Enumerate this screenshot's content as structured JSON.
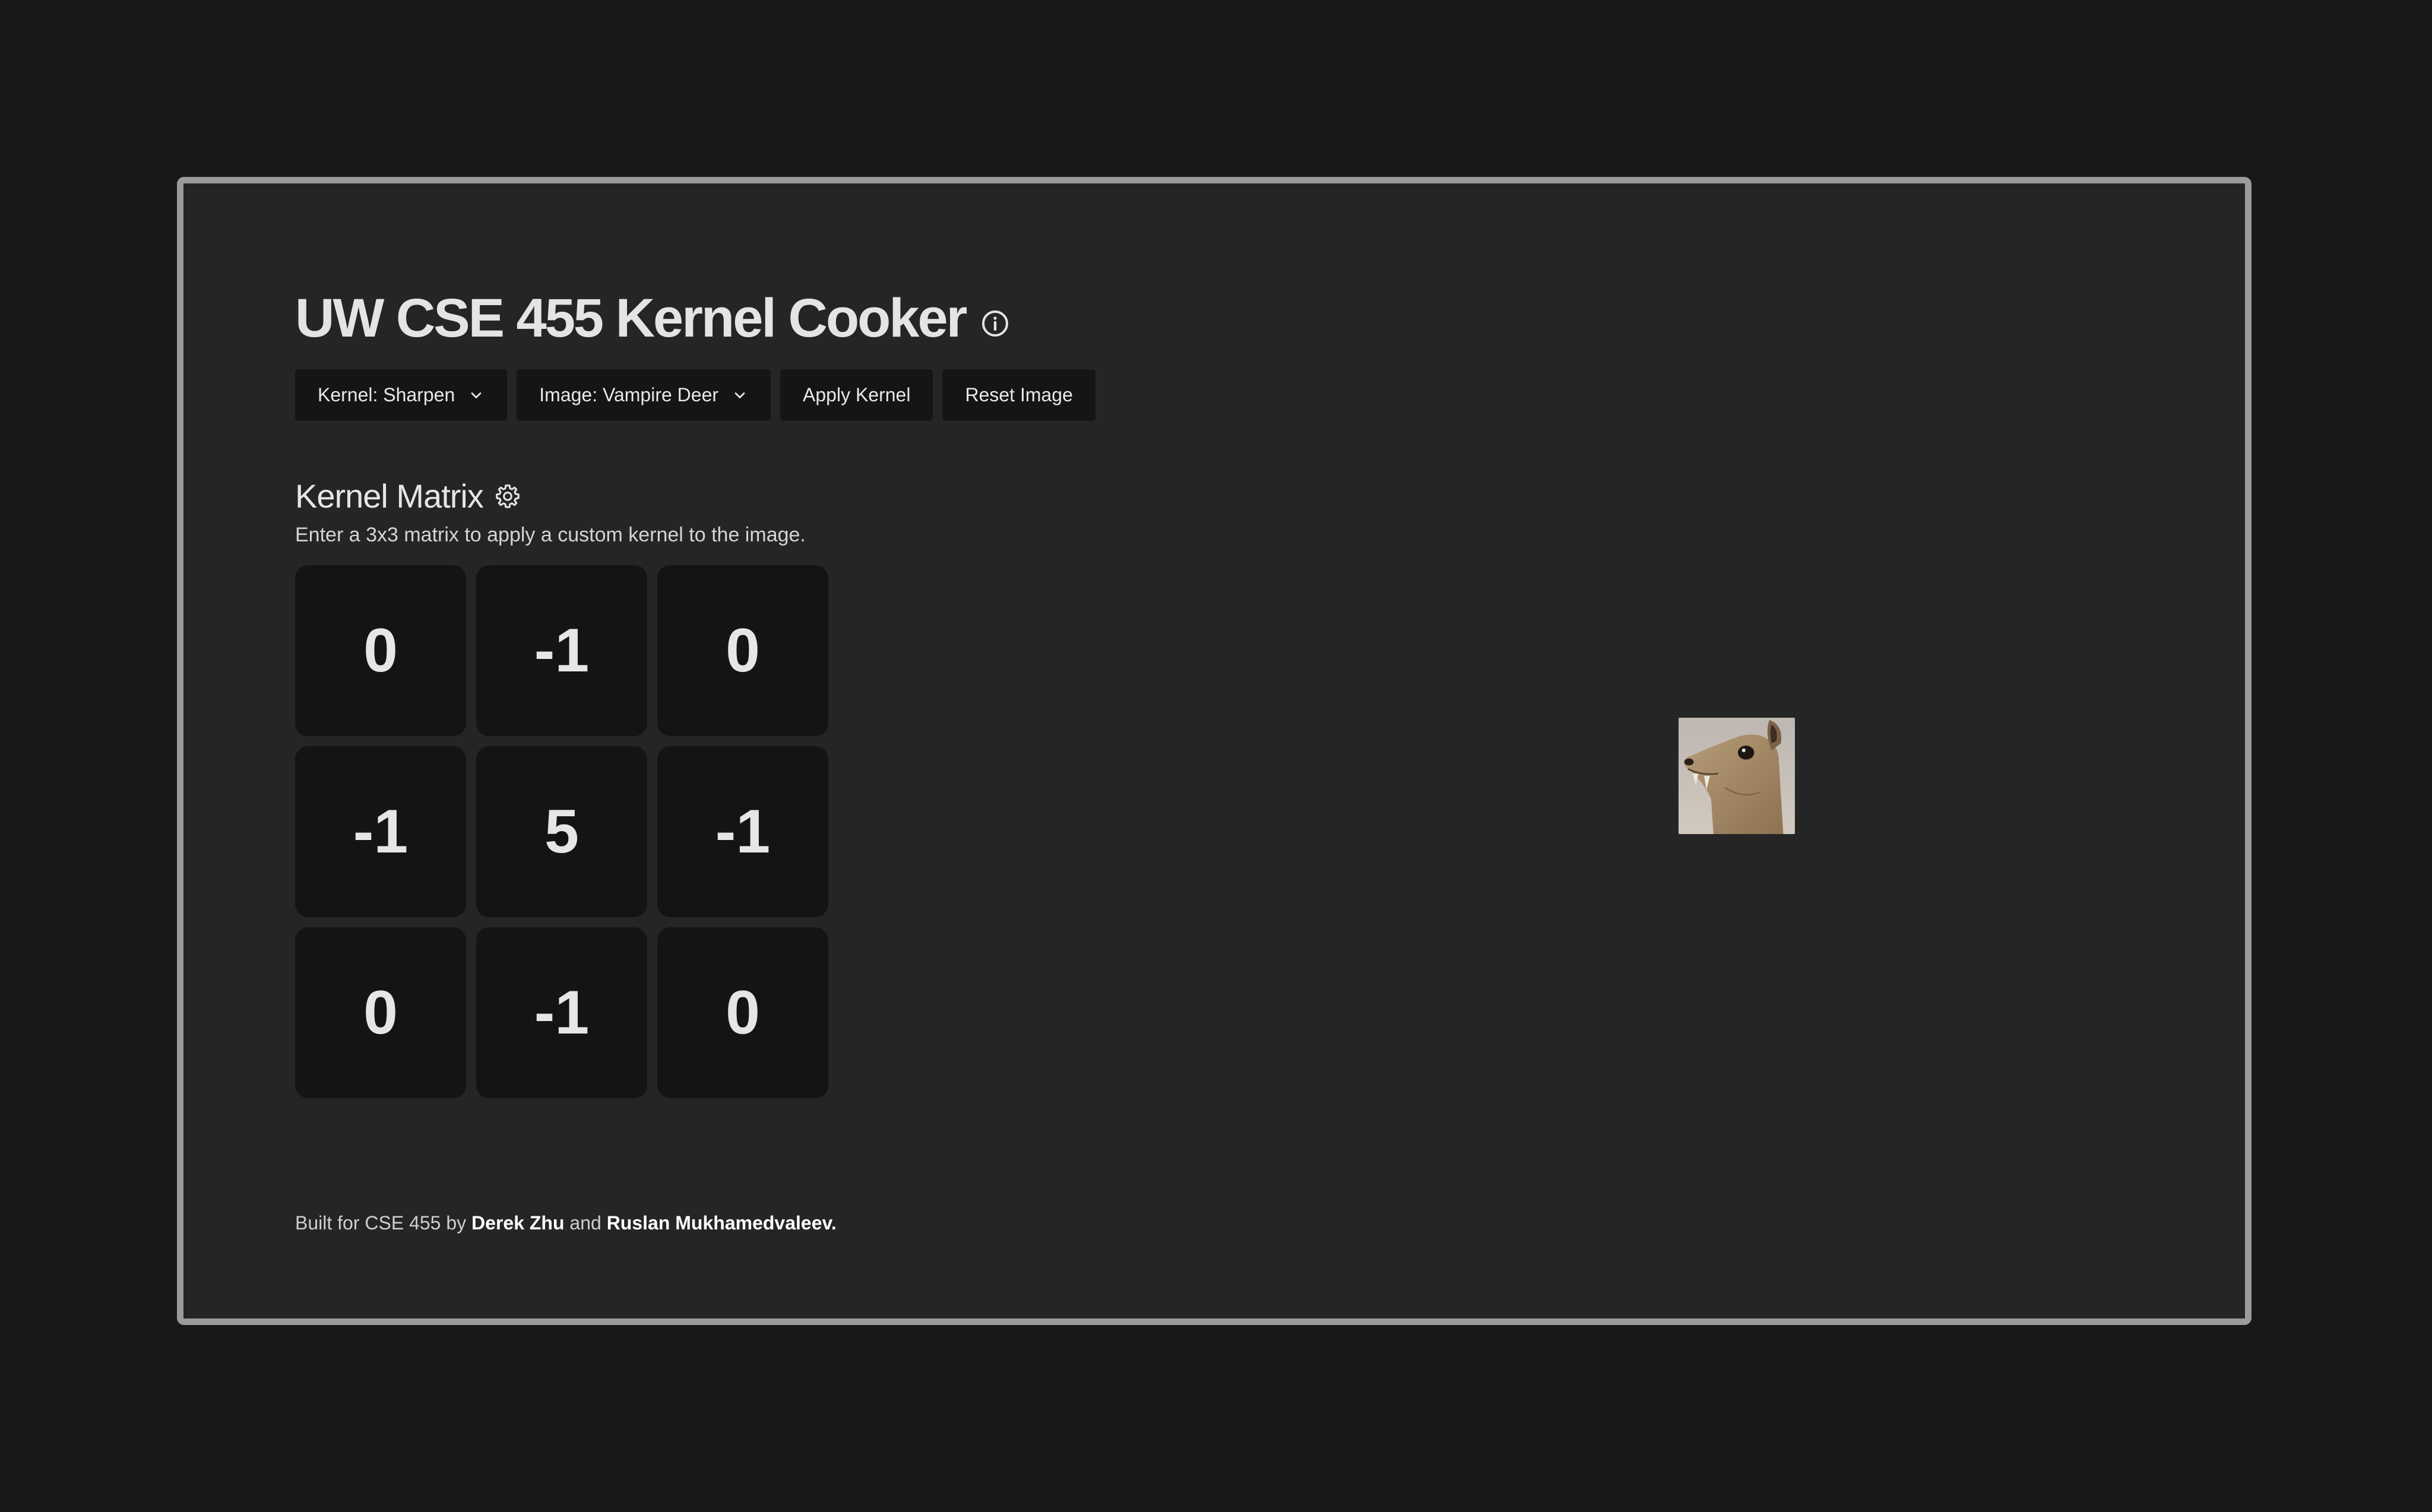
{
  "app": {
    "title": "UW CSE 455 Kernel Cooker"
  },
  "toolbar": {
    "kernel_select": "Kernel: Sharpen",
    "image_select": "Image: Vampire Deer",
    "apply_label": "Apply Kernel",
    "reset_label": "Reset Image"
  },
  "kernel": {
    "title": "Kernel Matrix",
    "description": "Enter a 3x3 matrix to apply a custom kernel to the image.",
    "cells": [
      "0",
      "-1",
      "0",
      "-1",
      "5",
      "-1",
      "0",
      "-1",
      "0"
    ]
  },
  "footer": {
    "prefix": "Built for CSE 455 by",
    "author1": "Derek Zhu",
    "conjunction": "and",
    "author2": "Ruslan Mukhamedvaleev",
    "suffix": "."
  },
  "icons": {
    "title_icon": "info-icon",
    "dropdown_icon": "chevron-down-icon",
    "section_icon": "gear-icon"
  },
  "colors": {
    "page_background": "#181818",
    "panel_background": "#252525",
    "panel_border": "#9b9b9b",
    "control_background": "#151515",
    "text": "#e4e4e4"
  }
}
